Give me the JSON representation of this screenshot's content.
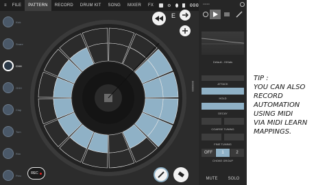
{
  "menu": {
    "items": [
      "FILE",
      "PATTERN",
      "RECORD",
      "DRUM KIT",
      "SONG",
      "MIXER",
      "FX"
    ],
    "active": "PATTERN",
    "display": "000"
  },
  "transport": {
    "rewind_icon": "rewind-icon",
    "e_label": "E",
    "next_icon": "arrow-right-icon",
    "add_icon": "plus-icon"
  },
  "tracks": {
    "selected_label": "CHH",
    "labels": [
      "Kick",
      "Snare",
      "CHH",
      "OHH",
      "Clap",
      "Tom",
      "Rim",
      "Perc"
    ],
    "selected_index": 2
  },
  "sequencer": {
    "outer_ring": [
      false,
      false,
      true,
      true,
      true,
      true,
      false,
      false,
      false,
      false,
      false,
      false,
      false,
      false,
      false,
      false
    ],
    "inner_ring": [
      false,
      false,
      true,
      true,
      true,
      true,
      true,
      false,
      true,
      true,
      true,
      true,
      true,
      true,
      true,
      false
    ],
    "active_color": "#8fb1c6",
    "inactive_color": "#2b2b2b",
    "rec_label": "REC",
    "rec_dot_color": "#e02020",
    "side_text": "0000000"
  },
  "panel": {
    "preset_name": "Default - HiHats",
    "sections": [
      {
        "label": "ATTACK"
      },
      {
        "label": "HOLD"
      },
      {
        "label": "DECAY"
      },
      {
        "label": "COARSE TUNING"
      },
      {
        "label": "FINE TUNING"
      },
      {
        "label": "CHOKE GROUP"
      }
    ],
    "choke_options": [
      "OFF",
      "1",
      "2"
    ],
    "choke_selected": "1",
    "mute_label": "MUTE",
    "solo_label": "SOLO",
    "edit_icons": [
      "circle-icon",
      "play-icon",
      "list-icon",
      "pencil-icon"
    ],
    "header_glyphs": "•••••••"
  },
  "tip": {
    "text": "TIP :\nYOU CAN ALSO\nRECORD\nAUTOMATION\nUSING MIDI\nVIA MIDI LEARN\nMAPPINGS."
  }
}
